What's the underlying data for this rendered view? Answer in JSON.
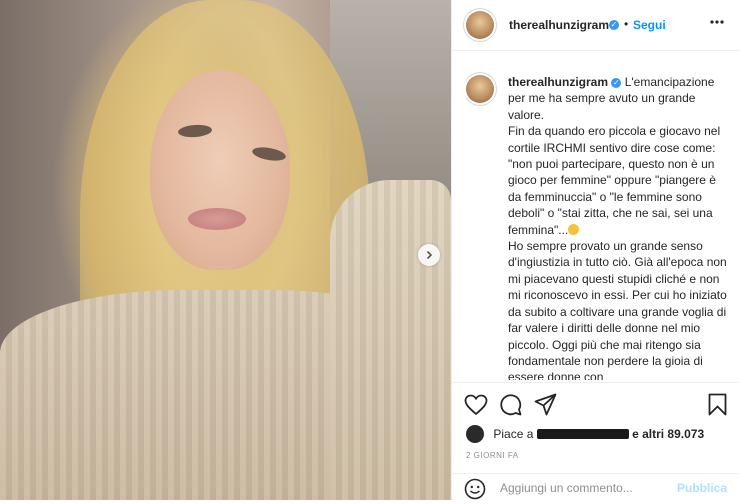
{
  "post": {
    "username": "therealhunzigram",
    "follow_label": "Segui",
    "caption_paragraphs": [
      "L'emancipazione per me ha sempre avuto un grande valore.",
      "Fin da quando ero piccola e giocavo nel cortile IRCHMI sentivo dire cose come: \"non puoi partecipare, questo non è un gioco per femmine\" oppure \"piangere è da femminuccia\" o \"le femmine sono deboli\" o \"stai zitta, che ne sai, sei una femmina\"...",
      "Ho sempre provato un grande senso d'ingiustizia in tutto ciò. Già all'epoca non mi piacevano questi stupidi cliché e non mi riconoscevo in essi. Per cui ho iniziato da subito a coltivare una grande voglia di far valere i diritti delle donne nel mio piccolo. Oggi più che mai ritengo sia fondamentale non perdere la gioia di essere donne con"
    ],
    "likes_prefix": "Piace a",
    "likes_suffix": "e altri 89.073",
    "timestamp": "2 GIORNI FA",
    "comment_placeholder": "Aggiungi un commento...",
    "publish_label": "Pubblica"
  },
  "colors": {
    "accent": "#0095f6",
    "publish_disabled": "#b2dffc",
    "verified": "#3897f0",
    "secondary_text": "#8e8e8e"
  },
  "icons": [
    "chevron-right-icon",
    "verified-badge-icon",
    "more-options-icon",
    "heart-icon",
    "comment-icon",
    "share-icon",
    "bookmark-icon",
    "emoji-icon"
  ]
}
